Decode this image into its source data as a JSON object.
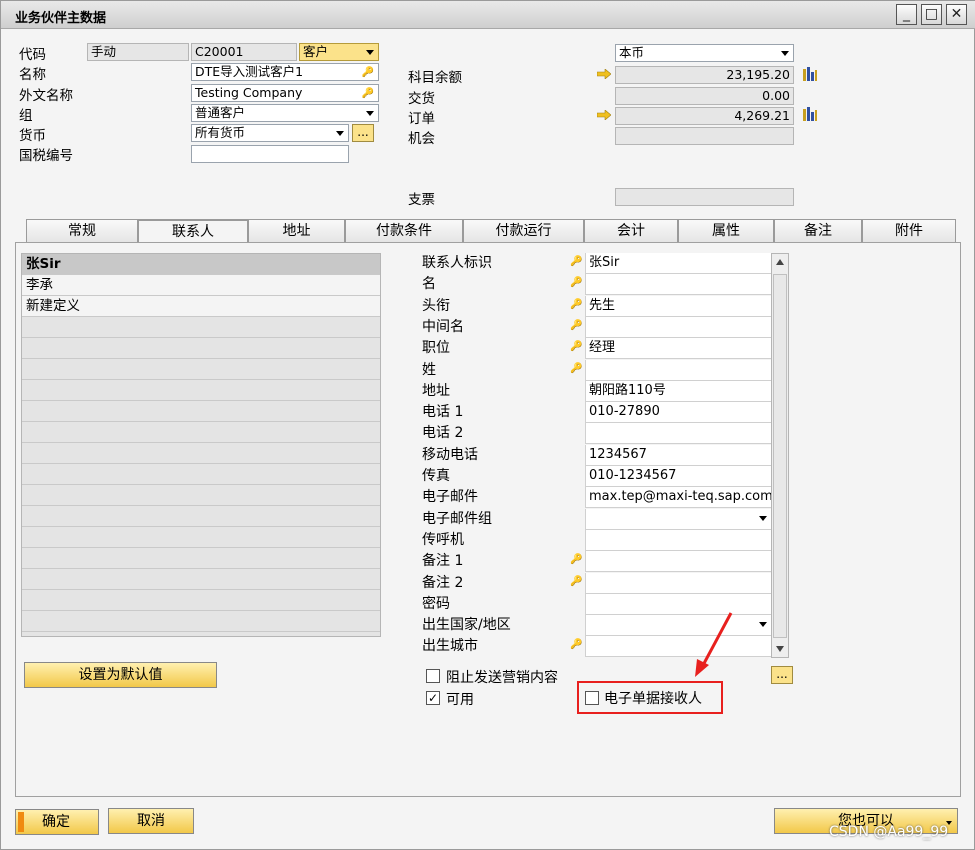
{
  "window": {
    "title": "业务伙伴主数据",
    "min_label": "_",
    "max_label": "□",
    "close_label": "✕"
  },
  "header": {
    "code_label": "代码",
    "code_mode": "手动",
    "code_value": "C20001",
    "type_value": "客户",
    "name_label": "名称",
    "name_value": "DTE导入测试客户1",
    "foreign_name_label": "外文名称",
    "foreign_name_value": "Testing Company",
    "group_label": "组",
    "group_value": "普通客户",
    "currency_label": "货币",
    "currency_value": "所有货币",
    "tax_label": "国税编号",
    "tax_value": "",
    "local_currency_value": "本币",
    "balance_label": "科目余额",
    "balance_value": "23,195.20",
    "delivery_label": "交货",
    "delivery_value": "0.00",
    "order_label": "订单",
    "order_value": "4,269.21",
    "opportunity_label": "机会",
    "opportunity_value": "",
    "check_label": "支票",
    "check_value": "",
    "dots_label": "..."
  },
  "tabs": [
    "常规",
    "联系人",
    "地址",
    "付款条件",
    "付款运行",
    "会计",
    "属性",
    "备注",
    "附件"
  ],
  "contacts": [
    "张Sir",
    "李承",
    "新建定义"
  ],
  "contact_fields": [
    {
      "label": "联系人标识",
      "key": true,
      "value": "张Sir"
    },
    {
      "label": "名",
      "key": true,
      "value": ""
    },
    {
      "label": "头衔",
      "key": true,
      "value": "先生"
    },
    {
      "label": "中间名",
      "key": true,
      "value": ""
    },
    {
      "label": "职位",
      "key": true,
      "value": "经理"
    },
    {
      "label": "姓",
      "key": true,
      "value": ""
    },
    {
      "label": "地址",
      "key": false,
      "value": "朝阳路110号"
    },
    {
      "label": "电话 1",
      "key": false,
      "value": "010-27890"
    },
    {
      "label": "电话 2",
      "key": false,
      "value": ""
    },
    {
      "label": "移动电话",
      "key": false,
      "value": "1234567"
    },
    {
      "label": "传真",
      "key": false,
      "value": "010-1234567"
    },
    {
      "label": "电子邮件",
      "key": false,
      "value": "max.tep@maxi-teq.sap.com"
    },
    {
      "label": "电子邮件组",
      "key": false,
      "value": "",
      "dropdown": true
    },
    {
      "label": "传呼机",
      "key": false,
      "value": ""
    },
    {
      "label": "备注 1",
      "key": true,
      "value": ""
    },
    {
      "label": "备注 2",
      "key": true,
      "value": ""
    },
    {
      "label": "密码",
      "key": false,
      "value": ""
    },
    {
      "label": "出生国家/地区",
      "key": false,
      "value": "",
      "dropdown": true
    },
    {
      "label": "出生城市",
      "key": true,
      "value": ""
    }
  ],
  "buttons": {
    "set_default": "设置为默认值",
    "ok": "确定",
    "cancel": "取消",
    "you_can_also": "您也可以"
  },
  "checkboxes": {
    "block_marketing": {
      "label": "阻止发送营销内容",
      "checked": false
    },
    "active": {
      "label": "可用",
      "checked": true
    },
    "e_doc_receiver": {
      "label": "电子单据接收人",
      "checked": false
    }
  },
  "key_icon": "🔑",
  "watermark": "CSDN @Aa99_99",
  "colors": {
    "highlight": "#e8201e",
    "button_yellow": "#f2c849"
  }
}
